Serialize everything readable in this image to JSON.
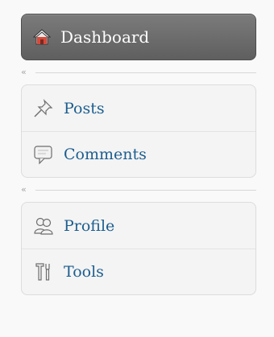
{
  "sidebar": {
    "dashboard": {
      "label": "Dashboard",
      "icon": "home-icon"
    },
    "group1": [
      {
        "label": "Posts",
        "icon": "pushpin-icon"
      },
      {
        "label": "Comments",
        "icon": "speech-bubble-icon"
      }
    ],
    "group2": [
      {
        "label": "Profile",
        "icon": "users-icon"
      },
      {
        "label": "Tools",
        "icon": "tools-icon"
      }
    ],
    "collapse_glyph": "«"
  },
  "colors": {
    "dashboard_bg": "#6b6b6b",
    "link": "#1d5e8f",
    "background": "#f9f9f9"
  }
}
